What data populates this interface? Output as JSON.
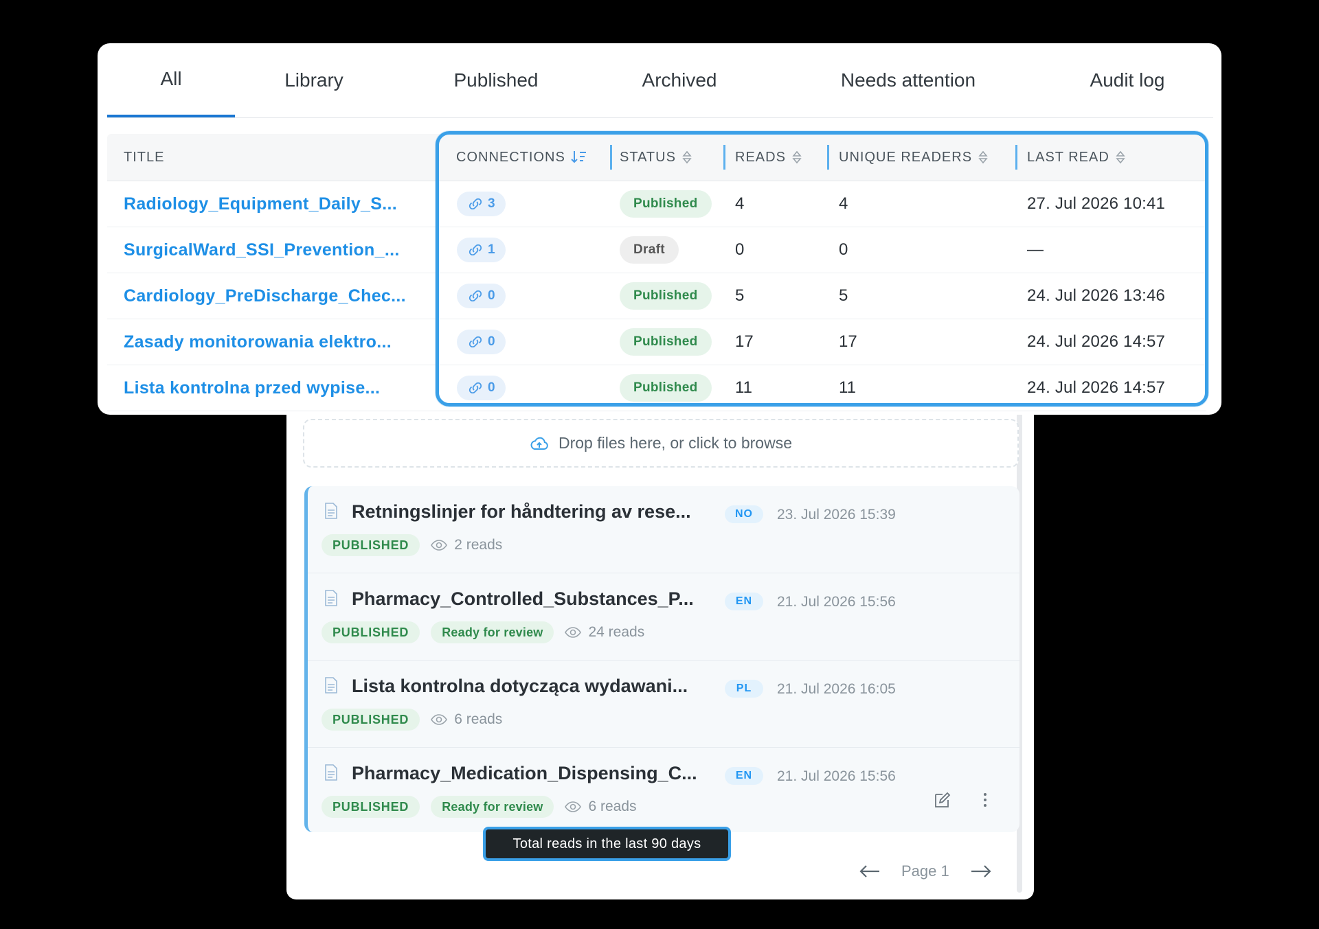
{
  "tabs": [
    {
      "label": "All",
      "active": true
    },
    {
      "label": "Library"
    },
    {
      "label": "Published"
    },
    {
      "label": "Archived"
    },
    {
      "label": "Needs attention"
    },
    {
      "label": "Audit log"
    }
  ],
  "table": {
    "headers": {
      "title": "TITLE",
      "connections": "CONNECTIONS",
      "status": "STATUS",
      "reads": "READS",
      "unique_readers": "UNIQUE READERS",
      "last_read": "LAST READ"
    },
    "rows": [
      {
        "title": "Radiology_Equipment_Daily_S...",
        "connections": "3",
        "status": "Published",
        "reads": "4",
        "unique_readers": "4",
        "last_read": "27. Jul 2026 10:41"
      },
      {
        "title": "SurgicalWard_SSI_Prevention_...",
        "connections": "1",
        "status": "Draft",
        "reads": "0",
        "unique_readers": "0",
        "last_read": "—"
      },
      {
        "title": "Cardiology_PreDischarge_Chec...",
        "connections": "0",
        "status": "Published",
        "reads": "5",
        "unique_readers": "5",
        "last_read": "24. Jul 2026 13:46"
      },
      {
        "title": "Zasady monitorowania elektro...",
        "connections": "0",
        "status": "Published",
        "reads": "17",
        "unique_readers": "17",
        "last_read": "24. Jul 2026 14:57"
      },
      {
        "title": "Lista kontrolna przed wypise...",
        "connections": "0",
        "status": "Published",
        "reads": "11",
        "unique_readers": "11",
        "last_read": "24. Jul 2026 14:57"
      }
    ]
  },
  "colors": {
    "published_bg": "#e6f4ea",
    "published_fg": "#2f8a4c",
    "draft_bg": "#eeeeee",
    "draft_fg": "#555555",
    "accent": "#3aa0e8",
    "link": "#1e8fe6"
  },
  "dropzone": {
    "label": "Drop files here, or click to browse",
    "icon": "cloud-upload-icon"
  },
  "documents": [
    {
      "title": "Retningslinjer for håndtering av rese...",
      "lang": "NO",
      "date": "23. Jul 2026 15:39",
      "badges": [
        "PUBLISHED"
      ],
      "reads": "2 reads"
    },
    {
      "title": "Pharmacy_Controlled_Substances_P...",
      "lang": "EN",
      "date": "21. Jul 2026 15:56",
      "badges": [
        "PUBLISHED",
        "Ready for review"
      ],
      "reads": "24 reads"
    },
    {
      "title": "Lista kontrolna dotycząca wydawani...",
      "lang": "PL",
      "date": "21. Jul 2026 16:05",
      "badges": [
        "PUBLISHED"
      ],
      "reads": "6 reads"
    },
    {
      "title": "Pharmacy_Medication_Dispensing_C...",
      "lang": "EN",
      "date": "21. Jul 2026 15:56",
      "badges": [
        "PUBLISHED",
        "Ready for review"
      ],
      "reads": "6 reads"
    }
  ],
  "tooltip": "Total reads in the last 90 days",
  "pagination": {
    "label": "Page 1"
  }
}
